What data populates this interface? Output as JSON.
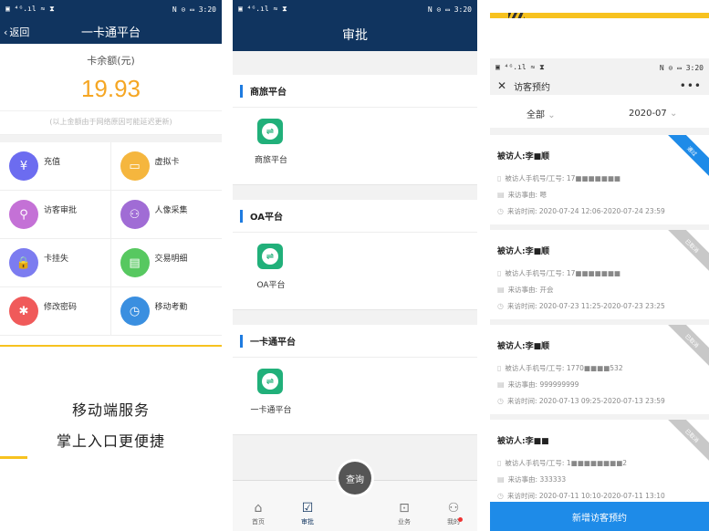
{
  "panel1": {
    "status": {
      "left": "▣ ⁴ᴳ.ıl ≈ ⧗",
      "right": "N ⊙ ▭ 3:20"
    },
    "nav": {
      "back_label": "返回",
      "title": "一卡通平台"
    },
    "balance": {
      "label": "卡余额(元)",
      "value": "19.93",
      "note": "(以上金额由于网络原因可能延迟更新)"
    },
    "grid": [
      {
        "label": "充值",
        "icon": "yuan-icon",
        "color": "#6c6cf0",
        "glyph": "¥"
      },
      {
        "label": "虚拟卡",
        "icon": "card-icon",
        "color": "#f5b63e",
        "glyph": "▭"
      },
      {
        "label": "访客审批",
        "icon": "visitor-approve-icon",
        "color": "#c471d6",
        "glyph": "⚲"
      },
      {
        "label": "人像采集",
        "icon": "face-capture-icon",
        "color": "#a06cd5",
        "glyph": "⚇"
      },
      {
        "label": "卡挂失",
        "icon": "lock-icon",
        "color": "#7c7cf0",
        "glyph": "🔒"
      },
      {
        "label": "交易明细",
        "icon": "receipt-icon",
        "color": "#57c860",
        "glyph": "▤"
      },
      {
        "label": "修改密码",
        "icon": "password-icon",
        "color": "#f05a5a",
        "glyph": "✱"
      },
      {
        "label": "移动考勤",
        "icon": "clock-icon",
        "color": "#3a8fe0",
        "glyph": "◷"
      }
    ],
    "promo": {
      "line1": "移动端服务",
      "line2": "掌上入口更便捷"
    }
  },
  "panel2": {
    "status": {
      "left": "▣ ⁴ᴳ.ıl ≈ ⧗",
      "right": "N ⊙ ▭ 3:20"
    },
    "title": "审批",
    "sections": [
      {
        "heading": "商旅平台",
        "app_label": "商旅平台"
      },
      {
        "heading": "OA平台",
        "app_label": "OA平台"
      },
      {
        "heading": "一卡通平台",
        "app_label": "一卡通平台"
      }
    ],
    "tabs": [
      {
        "label": "首页",
        "icon": "home-icon",
        "glyph": "⌂"
      },
      {
        "label": "审批",
        "icon": "approve-icon",
        "glyph": "☑"
      },
      {
        "label": "业务",
        "icon": "briefcase-icon",
        "glyph": "⊡"
      },
      {
        "label": "我的",
        "icon": "user-icon",
        "glyph": "⚇"
      }
    ],
    "fab_label": "查询"
  },
  "panel3": {
    "status": {
      "left": "▣ ⁴ᴳ.ıl ≈ ⧗",
      "right": "N ⊙ ▭ 3:20"
    },
    "title": "访客预约",
    "filter_all": "全部",
    "filter_month": "2020-07",
    "cards": [
      {
        "visitor": "被访人:李■顺",
        "phone": "被访人手机号/工号: 17■■■■■■■",
        "reason": "来访事由: 嗯",
        "time": "来访时间: 2020-07-24 12:06-2020-07-24 23:59",
        "ribbon": "通过",
        "ribbon_color": "#1e8be8"
      },
      {
        "visitor": "被访人:李■顺",
        "phone": "被访人手机号/工号: 17■■■■■■■",
        "reason": "来访事由: 开会",
        "time": "来访时间: 2020-07-23 11:25-2020-07-23 23:25",
        "ribbon": "已取消",
        "ribbon_color": "#c8c8c8"
      },
      {
        "visitor": "被访人:李■顺",
        "phone": "被访人手机号/工号: 1770■■■■532",
        "reason": "来访事由: 999999999",
        "time": "来访时间: 2020-07-13 09:25-2020-07-13 23:59",
        "ribbon": "已取消",
        "ribbon_color": "#c8c8c8"
      },
      {
        "visitor": "被访人:李■■",
        "phone": "被访人手机号/工号: 1■■■■■■■■2",
        "reason": "来访事由: 333333",
        "time": "来访时间: 2020-07-11 10:10-2020-07-11 13:10",
        "ribbon": "已取消",
        "ribbon_color": "#c8c8c8"
      }
    ],
    "add_button": "新增访客预约"
  }
}
